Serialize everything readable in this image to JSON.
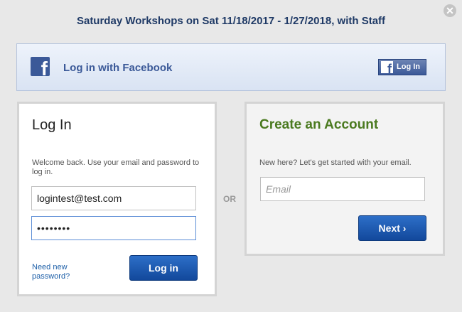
{
  "title": "Saturday Workshops on Sat 11/18/2017 - 1/27/2018, with Staff",
  "close_icon": "close-icon",
  "facebook": {
    "label": "Log in with Facebook",
    "button_label": "Log In",
    "icon": "facebook-icon",
    "brand_color": "#3b5998"
  },
  "login": {
    "heading": "Log In",
    "description": "Welcome back. Use your email and password to log in.",
    "email_value": "logintest@test.com",
    "password_value": "••••••••",
    "forgot_link": "Need new password?",
    "submit_label": "Log in"
  },
  "separator": "OR",
  "create_account": {
    "heading": "Create an Account",
    "description": "New here? Let's get started with your email.",
    "email_placeholder": "Email",
    "next_label": "Next ›",
    "heading_color": "#4a7a1f"
  }
}
